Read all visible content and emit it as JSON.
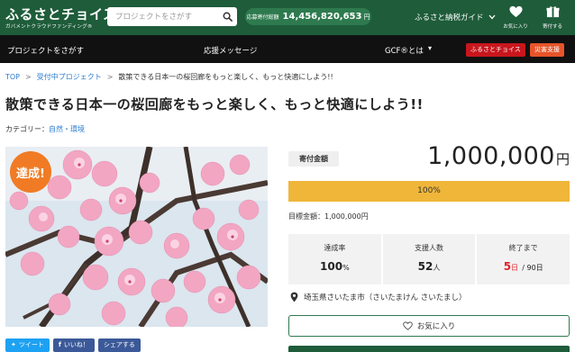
{
  "header": {
    "logo": {
      "main": "ふるさとチョイス",
      "sub": "ガバメントクラウドファンディング®"
    },
    "search": {
      "placeholder": "プロジェクトをさがす",
      "value": ""
    },
    "donation_total": {
      "label": "応募寄付総額",
      "value": "14,456,820,653",
      "unit": "円"
    },
    "guide_label": "ふるさと納税ガイド",
    "favorites_label": "お気に入り",
    "donate_label": "寄付する"
  },
  "nav": {
    "find_projects": "プロジェクトをさがす",
    "messages": "応援メッセージ",
    "about_gcf": "GCF®とは",
    "furusato_choice": "ふるさとチョイス",
    "disaster_support": "災害支援"
  },
  "breadcrumb": [
    "TOP",
    "受付中プロジェクト",
    "散策できる日本一の桜回廊をもっと楽しく、もっと快適にしよう!!"
  ],
  "page_title": "散策できる日本一の桜回廊をもっと楽しく、もっと快適にしよう!!",
  "category": {
    "label": "カテゴリー：",
    "value": "自然・環境"
  },
  "achieved_badge": "達成!",
  "share": {
    "tweet": "ツイート",
    "like": "いいね！",
    "share": "シェアする"
  },
  "funding": {
    "amount_label": "寄付金額",
    "amount": "1,000,000",
    "amount_unit": "円",
    "progress_percent": 100,
    "progress_text": "100%",
    "target_text": "目標金額：1,000,000円"
  },
  "stats": {
    "rate_label": "達成率",
    "rate_value": "100",
    "rate_unit": "%",
    "supporters_label": "支援人数",
    "supporters_value": "52",
    "supporters_unit": "人",
    "remaining_label": "終了まで",
    "remaining_days": "5",
    "remaining_unit": "日",
    "remaining_total": "/ 90日"
  },
  "location": "埼玉県さいたま市（さいたまけん さいたまし）",
  "favorite_button": "お気に入り",
  "colors": {
    "header_green": "#1e5c3a",
    "nav_black": "#111111",
    "progress": "#f0b63a",
    "badge_orange": "#f07b24",
    "link_blue": "#2b7ccf",
    "red": "#e0242a",
    "twitter": "#1da1f2",
    "facebook": "#3b5998",
    "disaster_badge": "#e8542a",
    "choice_badge": "#c8161d"
  }
}
